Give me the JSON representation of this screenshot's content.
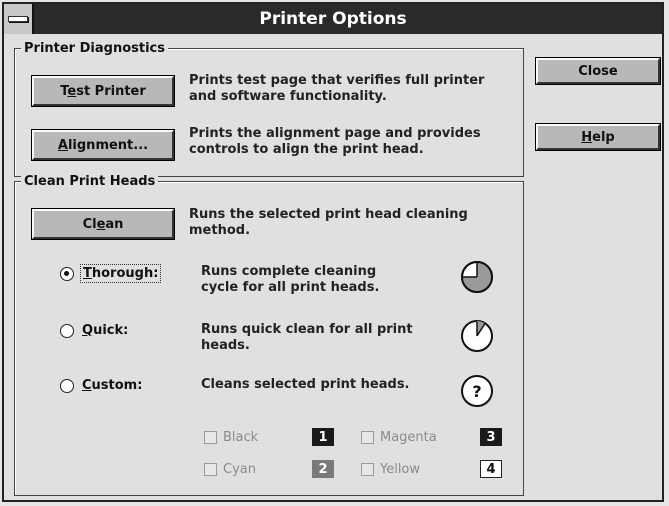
{
  "window": {
    "title": "Printer Options"
  },
  "side_buttons": {
    "close": "Close",
    "help": "Help"
  },
  "diagnostics": {
    "legend": "Printer Diagnostics",
    "test_button": "Test Printer",
    "test_desc_1": "Prints test page that verifies full printer",
    "test_desc_2": "and software functionality.",
    "align_button": "Alignment...",
    "align_desc_1": "Prints the alignment page and provides",
    "align_desc_2": "controls to align the print head."
  },
  "clean": {
    "legend": "Clean Print Heads",
    "clean_button": "Clean",
    "clean_desc_1": "Runs the selected print head cleaning",
    "clean_desc_2": "method.",
    "options": [
      {
        "label": "Thorough:",
        "desc_1": "Runs complete cleaning",
        "desc_2": "cycle for all print heads.",
        "checked": true
      },
      {
        "label": "Quick:",
        "desc_1": "Runs quick clean for all print",
        "desc_2": "heads.",
        "checked": false
      },
      {
        "label": "Custom:",
        "desc_1": "Cleans selected print heads.",
        "desc_2": "",
        "checked": false
      }
    ],
    "heads": [
      {
        "label": "Black",
        "number": "1"
      },
      {
        "label": "Magenta",
        "number": "3"
      },
      {
        "label": "Cyan",
        "number": "2"
      },
      {
        "label": "Yellow",
        "number": "4"
      }
    ]
  }
}
